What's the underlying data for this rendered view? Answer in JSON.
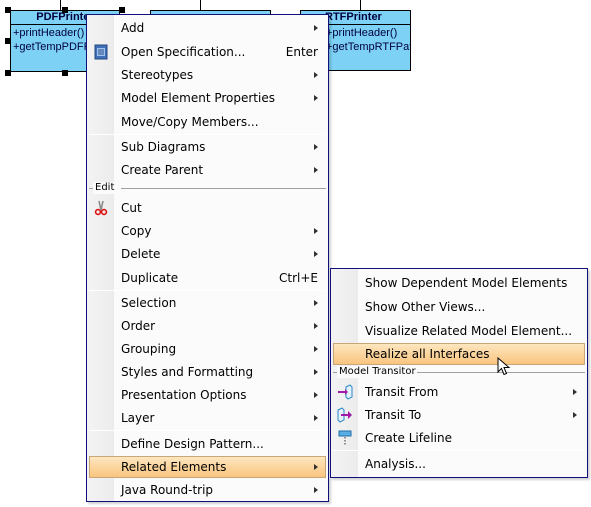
{
  "diagram": {
    "classes": [
      {
        "name": "PDFPrinter",
        "operations": [
          "+printHeader()",
          "+getTempPDFPath()"
        ]
      },
      {
        "name": "",
        "operations": []
      },
      {
        "name": "RTFPrinter",
        "operations": [
          "+printHeader()",
          "+getTempRTFPath()"
        ]
      }
    ],
    "colors": {
      "class_fill": "#7dd1f5",
      "menu_border": "#10107a",
      "highlight_top": "#fde6bf",
      "highlight_bottom": "#f9c57f"
    }
  },
  "main_menu": {
    "items": [
      {
        "label": "Add",
        "submenu": true
      },
      {
        "label": "Open Specification...",
        "shortcut": "Enter",
        "icon": "specification-icon"
      },
      {
        "label": "Stereotypes",
        "submenu": true
      },
      {
        "label": "Model Element Properties",
        "submenu": true
      },
      {
        "label": "Move/Copy Members..."
      },
      {
        "label": "Sub Diagrams",
        "submenu": true
      },
      {
        "label": "Create Parent",
        "submenu": true
      },
      {
        "label": "Cut",
        "icon": "scissors-icon"
      },
      {
        "label": "Copy",
        "submenu": true
      },
      {
        "label": "Delete",
        "submenu": true
      },
      {
        "label": "Duplicate",
        "shortcut": "Ctrl+E"
      },
      {
        "label": "Selection",
        "submenu": true
      },
      {
        "label": "Order",
        "submenu": true
      },
      {
        "label": "Grouping",
        "submenu": true
      },
      {
        "label": "Styles and Formatting",
        "submenu": true
      },
      {
        "label": "Presentation Options",
        "submenu": true
      },
      {
        "label": "Layer",
        "submenu": true
      },
      {
        "label": "Define Design Pattern..."
      },
      {
        "label": "Related Elements",
        "submenu": true,
        "highlighted": true
      },
      {
        "label": "Java Round-trip",
        "submenu": true
      }
    ],
    "groups": {
      "edit": "Edit"
    }
  },
  "sub_menu": {
    "items": [
      {
        "label": "Show Dependent Model Elements"
      },
      {
        "label": "Show Other Views..."
      },
      {
        "label": "Visualize Related Model Element..."
      },
      {
        "label": "Realize all Interfaces",
        "highlighted": true
      },
      {
        "label": "Transit From",
        "submenu": true,
        "icon": "transit-from-icon"
      },
      {
        "label": "Transit To",
        "submenu": true,
        "icon": "transit-to-icon"
      },
      {
        "label": "Create Lifeline",
        "icon": "lifeline-icon"
      },
      {
        "label": "Analysis..."
      }
    ],
    "groups": {
      "model_transitor": "Model Transitor"
    }
  }
}
